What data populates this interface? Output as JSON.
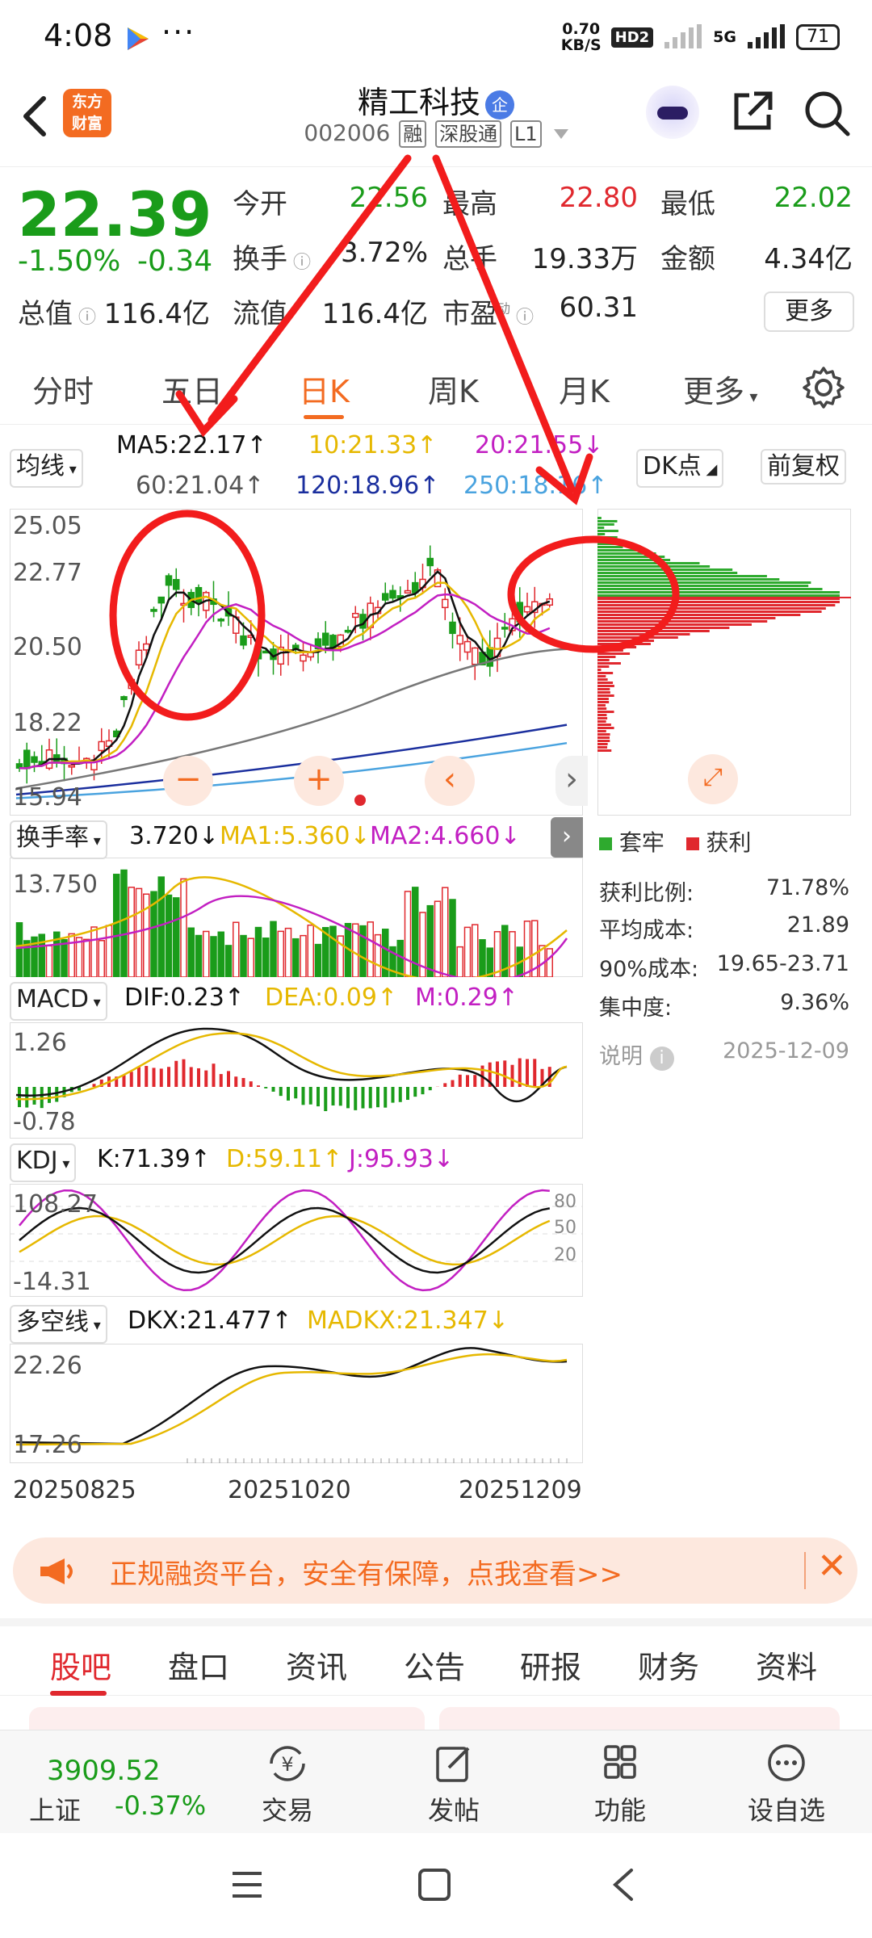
{
  "status_bar": {
    "time": "4:08",
    "more": "···",
    "speed_value": "0.70",
    "speed_unit": "KB/S",
    "hd": "HD2",
    "network": "5G",
    "battery": "71"
  },
  "header": {
    "logo_line1": "东方",
    "logo_line2": "财富",
    "stock_name": "精工科技",
    "qi_badge": "企",
    "stock_code": "002006",
    "tags": [
      "融",
      "深股通",
      "L1"
    ]
  },
  "quote": {
    "price": "22.39",
    "change_pct": "-1.50%",
    "change": "-0.34",
    "fields": [
      {
        "label": "今开",
        "value": "22.56",
        "color": "green"
      },
      {
        "label": "最高",
        "value": "22.80",
        "color": "red"
      },
      {
        "label": "最低",
        "value": "22.02",
        "color": "green"
      },
      {
        "label": "换手",
        "value": "3.72%",
        "color": "dark"
      },
      {
        "label": "总手",
        "value": "19.33万",
        "color": "dark"
      },
      {
        "label": "金额",
        "value": "4.34亿",
        "color": "dark"
      },
      {
        "label": "总值",
        "value": "116.4亿",
        "color": "dark"
      },
      {
        "label": "流值",
        "value": "116.4亿",
        "color": "dark"
      },
      {
        "label": "市盈",
        "value": "60.31",
        "color": "dark"
      }
    ],
    "pe_sup": "动",
    "more_button": "更多"
  },
  "periods": {
    "tabs": [
      "分时",
      "五日",
      "日K",
      "周K",
      "月K",
      "更多"
    ],
    "active": "日K"
  },
  "kline": {
    "indicator_select": "均线",
    "ma5": "MA5:22.17↑",
    "ma10": "10:21.33↑",
    "ma20": "20:21.55↓",
    "ma60": "60:21.04↑",
    "ma120": "120:18.96↑",
    "ma250": "250:18.16↑",
    "dk_select": "DK点",
    "fq_button": "前复权",
    "axis": [
      "25.05",
      "22.77",
      "20.50",
      "18.22",
      "15.94"
    ],
    "colors": {
      "up": "#e0282e",
      "down": "#1a9c1a",
      "ma5": "#111111",
      "ma10": "#e6b800",
      "ma20": "#c21fc2",
      "ma60": "#777777",
      "ma120": "#1b2f9e",
      "ma250": "#4aa3df"
    }
  },
  "chips": {
    "legend_trapped": "套牢",
    "legend_profit": "获利",
    "rows": [
      {
        "label": "获利比例:",
        "value": "71.78%"
      },
      {
        "label": "平均成本:",
        "value": "21.89"
      },
      {
        "label": "90%成本:",
        "value": "19.65-23.71"
      },
      {
        "label": "集中度:",
        "value": "9.36%"
      }
    ],
    "note_label": "说明",
    "date": "2025-12-09"
  },
  "volume": {
    "select": "换手率",
    "value": "3.720↓",
    "ma1": "MA1:5.360↓",
    "ma2": "MA2:4.660↓",
    "axis_top": "13.750"
  },
  "macd": {
    "select": "MACD",
    "dif": "DIF:0.23↑",
    "dea": "DEA:0.09↑",
    "m": "M:0.29↑",
    "axis_top": "1.26",
    "axis_bottom": "-0.78"
  },
  "kdj": {
    "select": "KDJ",
    "k": "K:71.39↑",
    "d": "D:59.11↑",
    "j": "J:95.93↓",
    "axis_top": "108.27",
    "axis_bottom": "-14.31",
    "levels": [
      "80",
      "50",
      "20"
    ]
  },
  "dkx": {
    "select": "多空线",
    "dkx": "DKX:21.477↑",
    "madkx": "MADKX:21.347↓",
    "axis_top": "22.26",
    "axis_bottom": "17.26"
  },
  "dates": [
    "20250825",
    "20251020",
    "20251209"
  ],
  "banner": {
    "text": "正规融资平台，安全有保障，点我查看>>"
  },
  "content_tabs": {
    "tabs": [
      "股吧",
      "盘口",
      "资讯",
      "公告",
      "研报",
      "财务",
      "资料"
    ],
    "active": "股吧"
  },
  "bottom_bar": {
    "index_value": "3909.52",
    "index_name": "上证",
    "index_change": "-0.37%",
    "items": [
      "交易",
      "发帖",
      "功能",
      "设自选"
    ]
  }
}
